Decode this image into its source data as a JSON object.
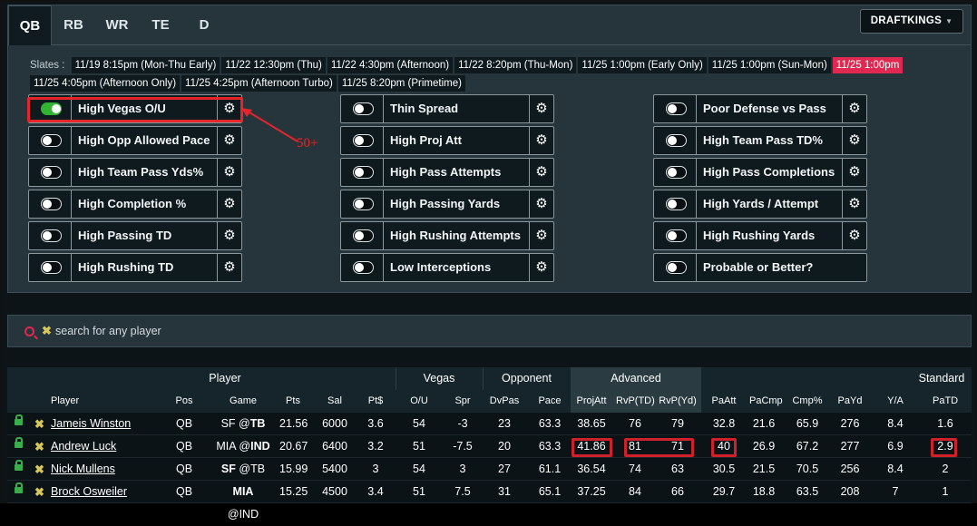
{
  "tabs": [
    {
      "label": "QB",
      "active": true
    },
    {
      "label": "RB"
    },
    {
      "label": "WR"
    },
    {
      "label": "TE"
    },
    {
      "label": "D"
    }
  ],
  "site": {
    "label": "DRAFTKINGS"
  },
  "slates": {
    "label": "Slates :",
    "items": [
      {
        "label": "11/19 8:15pm (Mon-Thu Early)"
      },
      {
        "label": "11/22 12:30pm (Thu)"
      },
      {
        "label": "11/22 4:30pm (Afternoon)"
      },
      {
        "label": "11/22 8:20pm (Thu-Mon)"
      },
      {
        "label": "11/25 1:00pm (Early Only)"
      },
      {
        "label": "11/25 1:00pm (Sun-Mon)"
      },
      {
        "label": "11/25 1:00pm",
        "selected": true
      },
      {
        "label": "11/25 4:05pm (Afternoon Only)"
      },
      {
        "label": "11/25 4:25pm (Afternoon Turbo)"
      },
      {
        "label": "11/25 8:20pm (Primetime)"
      }
    ]
  },
  "filters": [
    [
      {
        "label": "High Vegas O/U",
        "on": true,
        "gear": true
      },
      {
        "label": "High Opp Allowed Pace",
        "gear": true
      },
      {
        "label": "High Team Pass Yds%",
        "gear": true
      },
      {
        "label": "High Completion %",
        "gear": true
      },
      {
        "label": "High Passing TD",
        "gear": true
      },
      {
        "label": "High Rushing TD",
        "gear": true
      }
    ],
    [
      {
        "label": "Thin Spread",
        "gear": true
      },
      {
        "label": "High Proj Att",
        "gear": true
      },
      {
        "label": "High Pass Attempts",
        "gear": true
      },
      {
        "label": "High Passing Yards",
        "gear": true
      },
      {
        "label": "High Rushing Attempts",
        "gear": true
      },
      {
        "label": "Low Interceptions",
        "gear": true
      }
    ],
    [
      {
        "label": "Poor Defense vs Pass",
        "gear": true
      },
      {
        "label": "High Team Pass TD%",
        "gear": true
      },
      {
        "label": "High Pass Completions",
        "gear": true
      },
      {
        "label": "High Yards / Attempt",
        "gear": true
      },
      {
        "label": "High Rushing Yards",
        "gear": true
      },
      {
        "label": "Probable or Better?",
        "gear": false
      }
    ]
  ],
  "annotation": "50+",
  "search": {
    "placeholder": "search for any player"
  },
  "table": {
    "groups": {
      "player": "Player",
      "vegas": "Vegas",
      "opponent": "Opponent",
      "advanced": "Advanced",
      "standard": "Standard"
    },
    "columns": [
      "Player",
      "Pos",
      "Game",
      "Pts",
      "Sal",
      "Pt$",
      "O/U",
      "Spr",
      "DvPas",
      "Pace",
      "ProjAtt",
      "RvP(TD)",
      "RvP(Yd)",
      "PaAtt",
      "PaCmp",
      "Cmp%",
      "PaYd",
      "Y/A",
      "PaTD"
    ],
    "rows": [
      {
        "player": "Jameis Winston",
        "pos": "QB",
        "away": "SF",
        "home": "TB",
        "bold": "home",
        "pts": "21.56",
        "sal": "6000",
        "pt$": "3.6",
        "ou": "54",
        "spr": "-3",
        "dvpas": "23",
        "pace": "63.3",
        "projatt": "38.65",
        "rvptd": "76",
        "rvpyd": "79",
        "paatt": "32.8",
        "pacmp": "21.6",
        "cmp": "65.9",
        "payd": "276",
        "ya": "8.4",
        "patd": "1.6"
      },
      {
        "player": "Andrew Luck",
        "pos": "QB",
        "away": "MIA",
        "home": "IND",
        "bold": "home",
        "pts": "20.67",
        "sal": "6400",
        "pt$": "3.2",
        "ou": "51",
        "spr": "-7.5",
        "dvpas": "20",
        "pace": "63.3",
        "projatt": "41.86",
        "rvptd": "81",
        "rvpyd": "71",
        "paatt": "40",
        "pacmp": "26.9",
        "cmp": "67.2",
        "payd": "277",
        "ya": "6.9",
        "patd": "2.9"
      },
      {
        "player": "Nick Mullens",
        "pos": "QB",
        "away": "SF",
        "home": "TB",
        "bold": "away",
        "pts": "15.99",
        "sal": "5400",
        "pt$": "3",
        "ou": "54",
        "spr": "3",
        "dvpas": "27",
        "pace": "61.1",
        "projatt": "36.54",
        "rvptd": "74",
        "rvpyd": "63",
        "paatt": "30.5",
        "pacmp": "21.5",
        "cmp": "70.5",
        "payd": "256",
        "ya": "8.4",
        "patd": "2"
      },
      {
        "player": "Brock Osweiler",
        "pos": "QB",
        "away": "MIA",
        "home": "IND",
        "bold": "away",
        "pts": "15.25",
        "sal": "4500",
        "pt$": "3.4",
        "ou": "51",
        "spr": "7.5",
        "dvpas": "31",
        "pace": "65.1",
        "projatt": "37.25",
        "rvptd": "84",
        "rvpyd": "66",
        "paatt": "29.7",
        "pacmp": "18.8",
        "cmp": "63.5",
        "payd": "208",
        "ya": "7",
        "patd": "1"
      }
    ]
  },
  "colors": {
    "accent": "#e02850",
    "toggle_on": "#34b233",
    "highlight": "#e4262b"
  }
}
